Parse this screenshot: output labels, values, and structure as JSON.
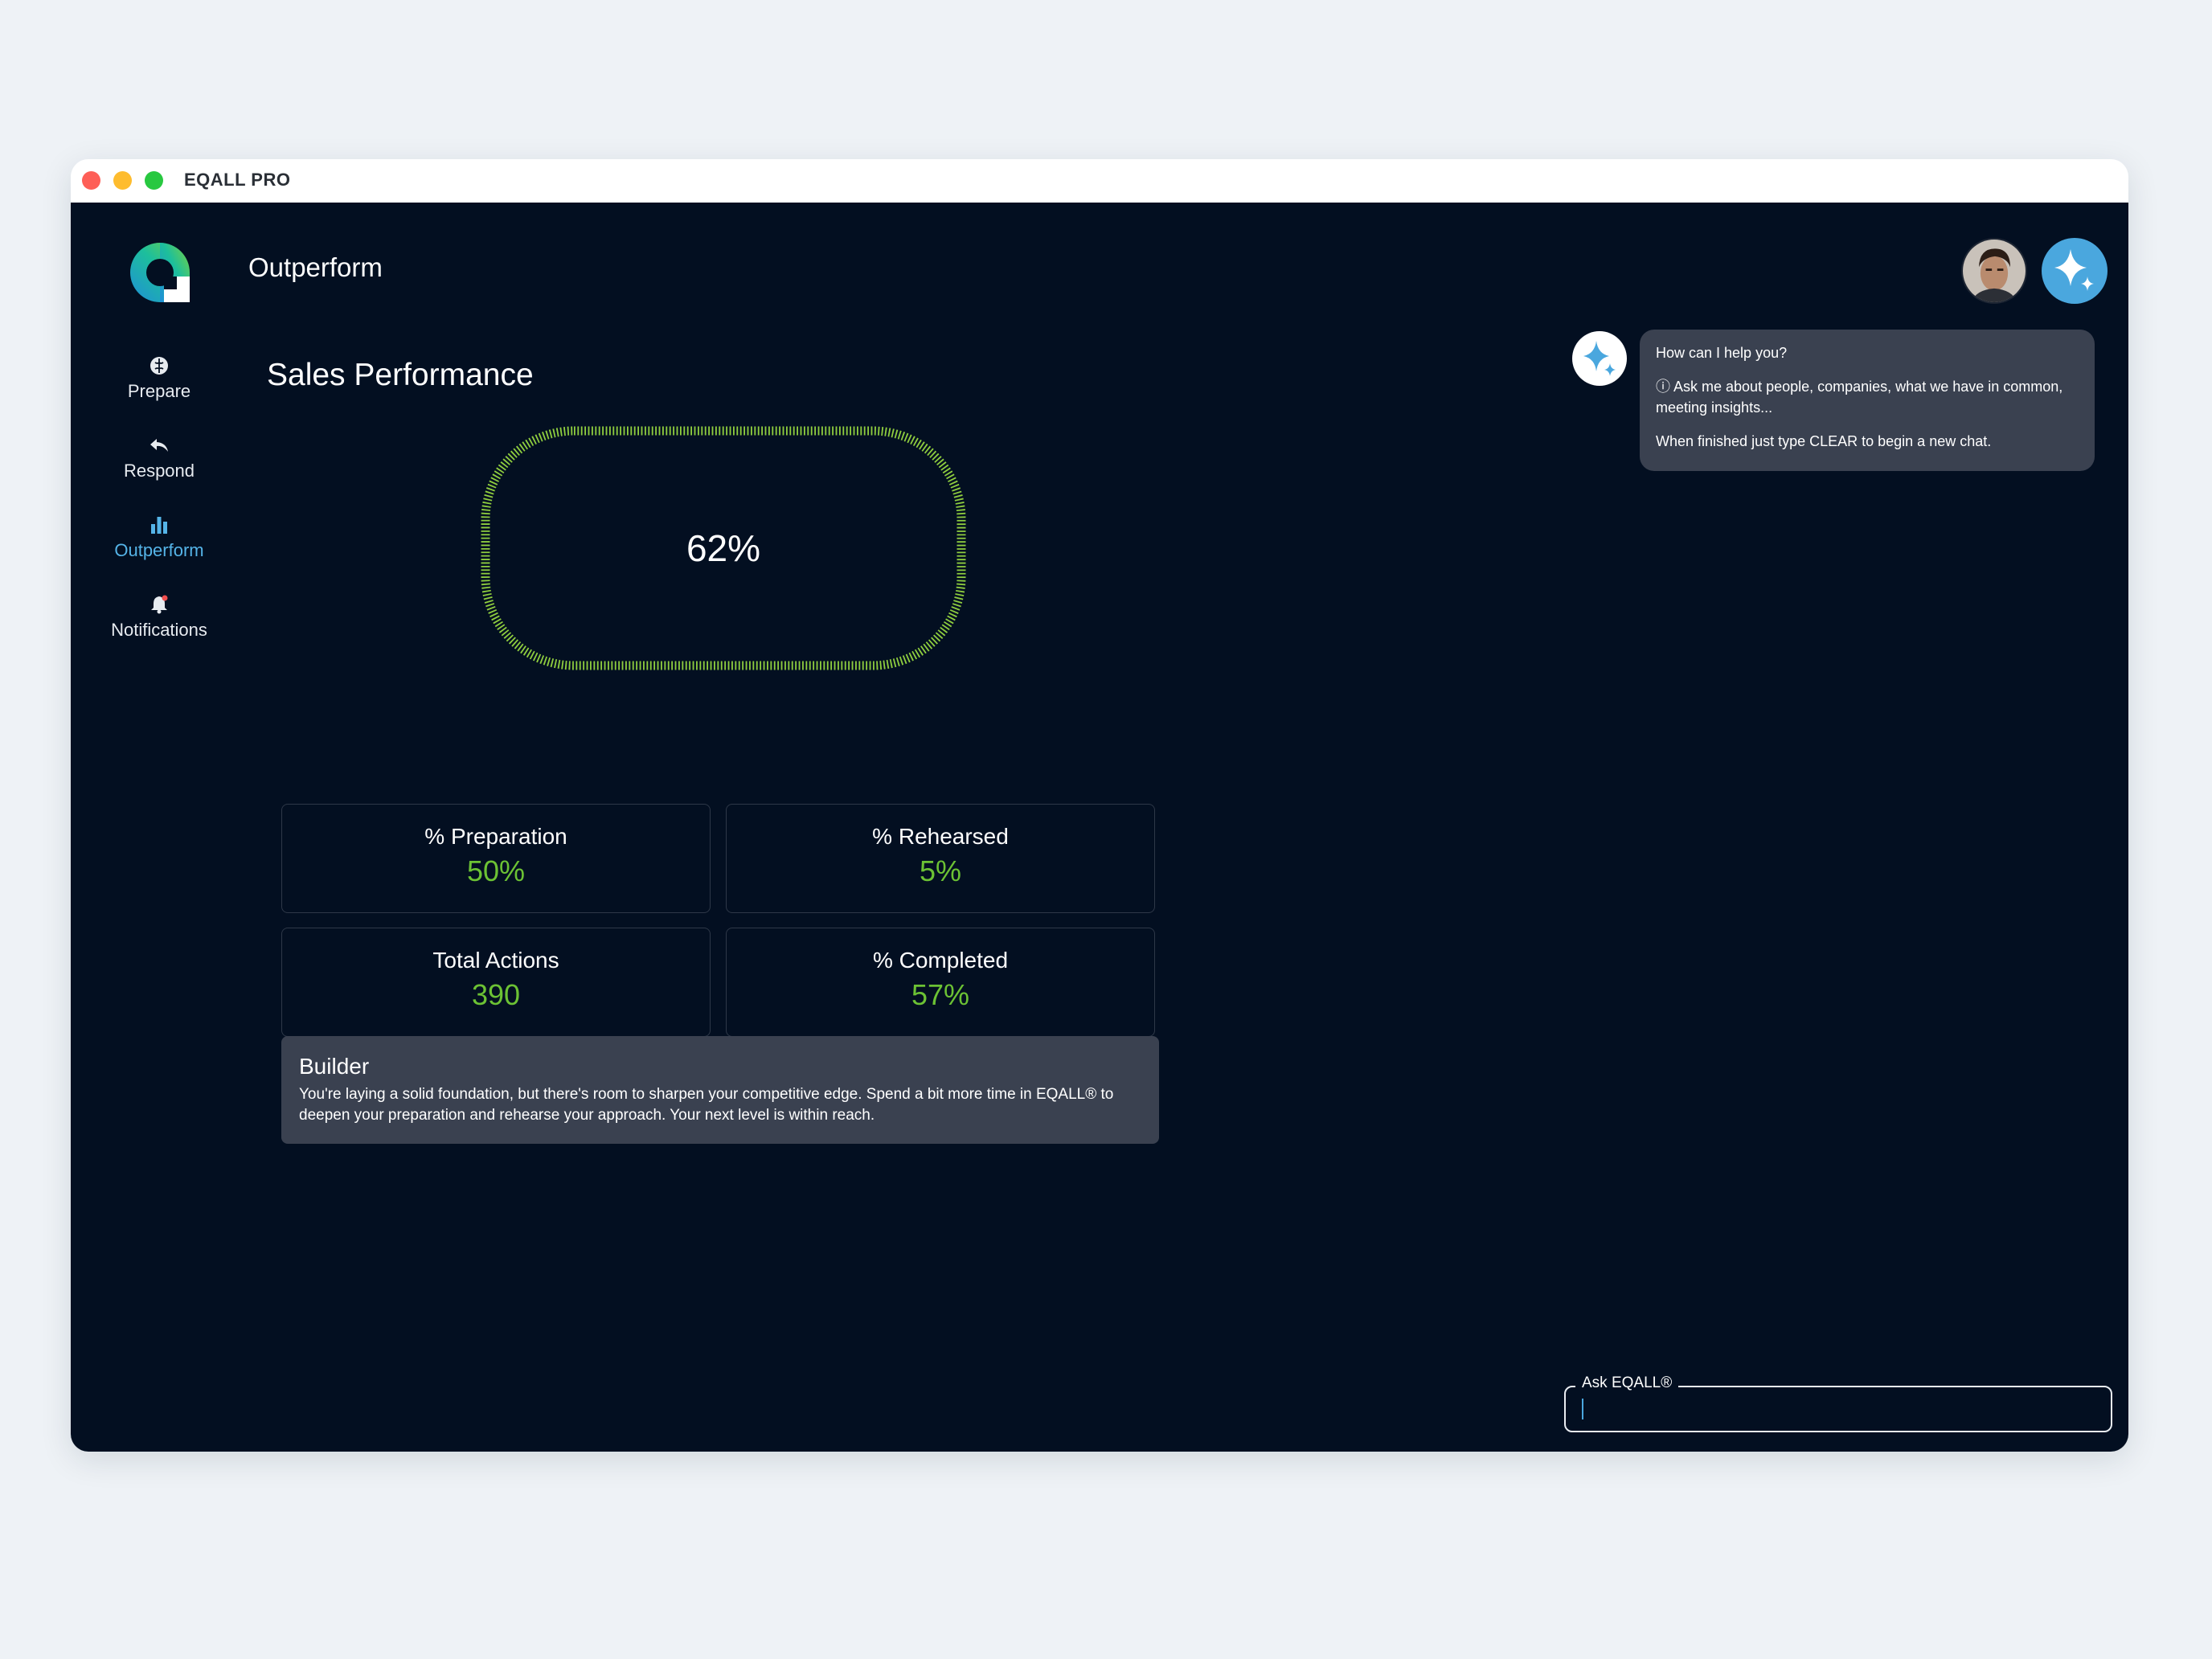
{
  "window": {
    "title": "EQALL PRO"
  },
  "header": {
    "title": "Outperform"
  },
  "sidebar": {
    "items": [
      {
        "label": "Prepare",
        "icon": "brain-icon",
        "active": false
      },
      {
        "label": "Respond",
        "icon": "reply-icon",
        "active": false
      },
      {
        "label": "Outperform",
        "icon": "bar-chart-icon",
        "active": true
      },
      {
        "label": "Notifications",
        "icon": "bell-icon",
        "active": false
      }
    ]
  },
  "main": {
    "title": "Sales Performance",
    "gauge": {
      "value_text": "62%",
      "value": 0.62,
      "color": "#8fce3f"
    },
    "stats": [
      {
        "label": "% Preparation",
        "value": "50%"
      },
      {
        "label": "% Rehearsed",
        "value": "5%"
      },
      {
        "label": "Total Actions",
        "value": "390"
      },
      {
        "label": "% Completed",
        "value": "57%"
      }
    ],
    "builder": {
      "title": "Builder",
      "text": "You're laying a solid foundation, but there's room to sharpen your competitive edge. Spend a bit more time in EQALL® to deepen your preparation and rehearse your approach. Your next level is within reach."
    }
  },
  "chat": {
    "messages": [
      "How can I help you?",
      "ⓘ Ask me about people, companies, what we have in common, meeting insights...",
      "When finished just type CLEAR to begin a new chat."
    ],
    "input": {
      "label": "Ask EQALL®",
      "value": ""
    }
  },
  "colors": {
    "accent": "#4aa7de",
    "success": "#6cc234",
    "background": "#030f21",
    "card": "#3a4150"
  }
}
